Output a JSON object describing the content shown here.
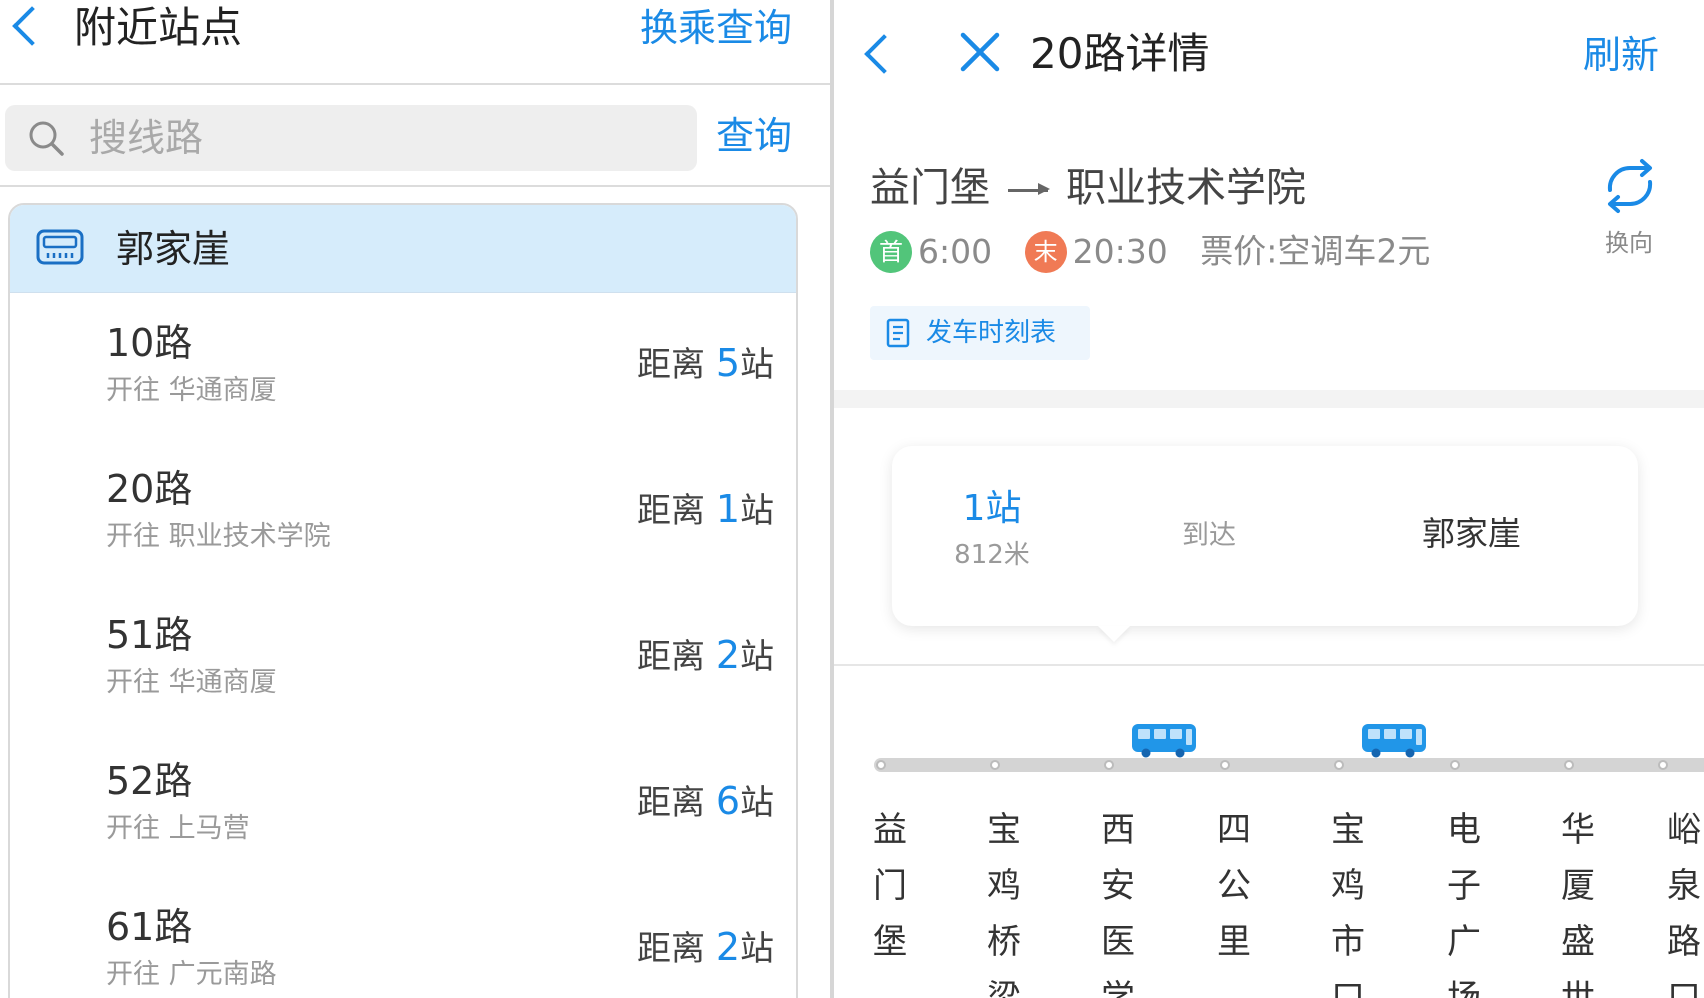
{
  "left": {
    "title": "附近站点",
    "transfer_link": "换乘查询",
    "search": {
      "placeholder": "搜线路",
      "button": "查询"
    },
    "stop": {
      "name": "郭家崖",
      "routes": [
        {
          "name": "10路",
          "direction": "开往 华通商厦",
          "distance_prefix": "距离 ",
          "distance_num": "5",
          "distance_unit": "站"
        },
        {
          "name": "20路",
          "direction": "开往 职业技术学院",
          "distance_prefix": "距离 ",
          "distance_num": "1",
          "distance_unit": "站"
        },
        {
          "name": "51路",
          "direction": "开往 华通商厦",
          "distance_prefix": "距离 ",
          "distance_num": "2",
          "distance_unit": "站"
        },
        {
          "name": "52路",
          "direction": "开往 上马营",
          "distance_prefix": "距离 ",
          "distance_num": "6",
          "distance_unit": "站"
        },
        {
          "name": "61路",
          "direction": "开往 广元南路",
          "distance_prefix": "距离 ",
          "distance_num": "2",
          "distance_unit": "站"
        }
      ]
    }
  },
  "right": {
    "title": "20路详情",
    "refresh": "刷新",
    "from": "益门堡",
    "to": "职业技术学院",
    "swap_label": "换向",
    "first_badge": "首",
    "first_time": "6:00",
    "last_badge": "末",
    "last_time": "20:30",
    "price": "票价:空调车2元",
    "timetable_label": "发车时刻表",
    "arrival": {
      "stops": "1站",
      "meters": "812米",
      "arrive_label": "到达",
      "stop_name": "郭家崖"
    },
    "stations": [
      "益门堡",
      "宝鸡桥梁",
      "西安医学",
      "四公里",
      "宝鸡市口",
      "电子广场",
      "华厦盛世",
      "峪泉路口"
    ]
  },
  "colors": {
    "accent": "#1a8ae6",
    "first_badge": "#52c57a",
    "last_badge": "#f07a55",
    "stop_header_bg": "#d6ecfb"
  },
  "icons": [
    "back-chevron-icon",
    "search-icon",
    "bus-stop-icon",
    "close-icon",
    "swap-direction-icon",
    "timetable-icon",
    "bus-icon"
  ]
}
